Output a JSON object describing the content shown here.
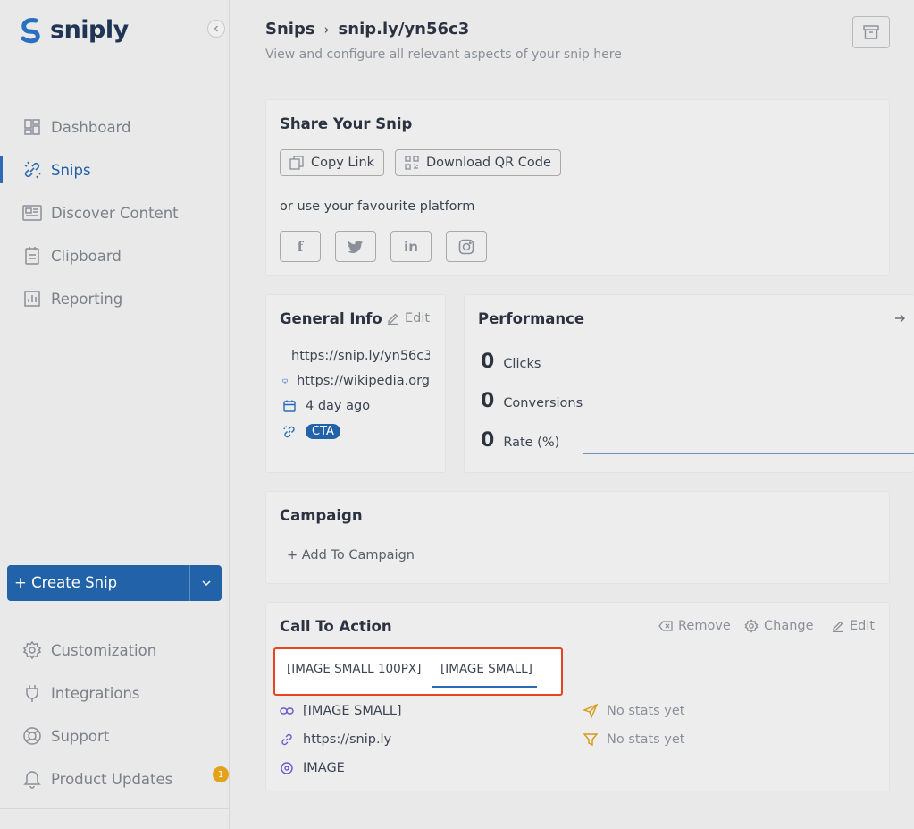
{
  "brand": {
    "name": "sniply"
  },
  "nav": {
    "dashboard": "Dashboard",
    "snips": "Snips",
    "discover": "Discover Content",
    "clipboard": "Clipboard",
    "reporting": "Reporting",
    "customization": "Customization",
    "integrations": "Integrations",
    "support": "Support",
    "product_updates": "Product Updates",
    "updates_badge": "1"
  },
  "create_button": "+ Create Snip",
  "header": {
    "crumb_root": "Snips",
    "crumb_sep": "›",
    "crumb_current": "snip.ly/yn56c3",
    "subtitle": "View and configure all relevant aspects of your snip here"
  },
  "share": {
    "title": "Share Your Snip",
    "copy_link": "Copy Link",
    "download_qr": "Download QR Code",
    "platform_text": "or use your favourite platform"
  },
  "general_info": {
    "title": "General Info",
    "edit": "Edit",
    "snip_url": "https://snip.ly/yn56c3",
    "target_url": "https://wikipedia.org",
    "created": "4 day ago",
    "tag": "CTA"
  },
  "performance": {
    "title": "Performance",
    "clicks_value": "0",
    "clicks_label": "Clicks",
    "conversions_value": "0",
    "conversions_label": "Conversions",
    "rate_value": "0",
    "rate_label": "Rate (%)"
  },
  "campaign": {
    "title": "Campaign",
    "add": "+ Add To Campaign"
  },
  "cta": {
    "title": "Call To Action",
    "remove": "Remove",
    "change": "Change",
    "edit": "Edit",
    "tab_1": "[IMAGE SMALL 100PX]",
    "tab_2": "[IMAGE SMALL]",
    "name": "[IMAGE SMALL]",
    "url": "https://snip.ly",
    "type": "IMAGE",
    "stat_1": "No stats yet",
    "stat_2": "No stats yet"
  },
  "colors": {
    "brand_blue": "#2262a9",
    "highlight_red": "#e8451f",
    "badge_amber": "#e3a21a"
  }
}
